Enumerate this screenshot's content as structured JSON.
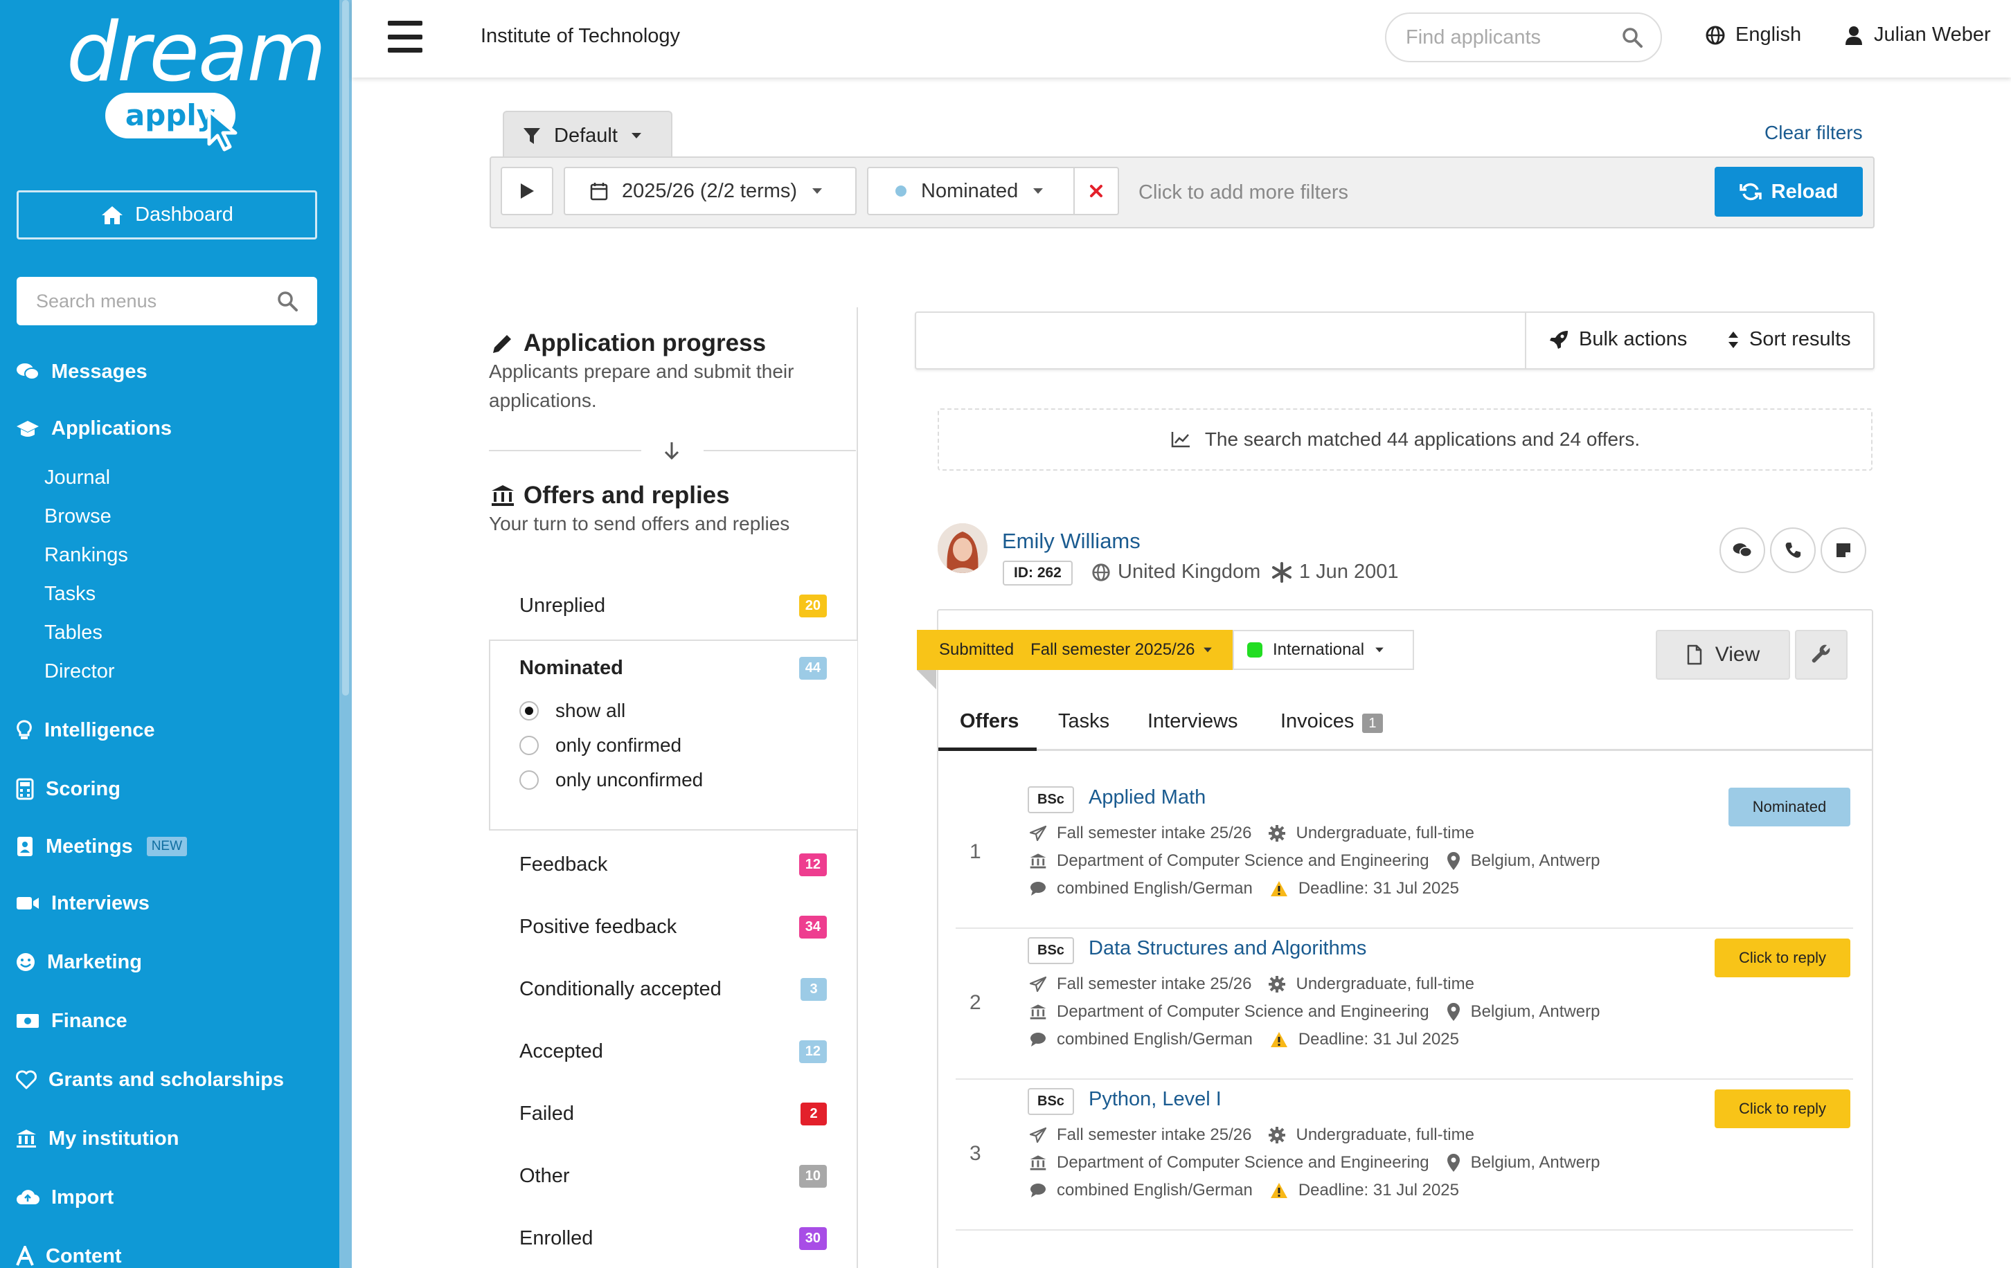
{
  "sidebar": {
    "logo_top": "dream",
    "logo_bottom": "apply",
    "dashboard_label": "Dashboard",
    "search_placeholder": "Search menus",
    "nav": [
      {
        "label": "Messages",
        "icon": "comments-icon"
      },
      {
        "label": "Applications",
        "icon": "graduation-cap-icon"
      },
      {
        "label": "Intelligence",
        "icon": "lightbulb-icon"
      },
      {
        "label": "Scoring",
        "icon": "calculator-icon"
      },
      {
        "label": "Meetings",
        "icon": "contact-card-icon",
        "badge": "NEW"
      },
      {
        "label": "Interviews",
        "icon": "video-icon"
      },
      {
        "label": "Marketing",
        "icon": "smile-icon"
      },
      {
        "label": "Finance",
        "icon": "money-icon"
      },
      {
        "label": "Grants and scholarships",
        "icon": "heart-icon"
      },
      {
        "label": "My institution",
        "icon": "institution-icon"
      },
      {
        "label": "Import",
        "icon": "cloud-upload-icon"
      },
      {
        "label": "Content",
        "icon": "font-icon"
      }
    ],
    "sub_items": [
      "Journal",
      "Browse",
      "Rankings",
      "Tasks",
      "Tables",
      "Director"
    ]
  },
  "header": {
    "institution": "Institute of Technology",
    "find_placeholder": "Find applicants",
    "language": "English",
    "user": "Julian Weber"
  },
  "filters": {
    "preset": "Default",
    "clear_label": "Clear filters",
    "term": "2025/26 (2/2 terms)",
    "status": "Nominated",
    "add_more": "Click to add more filters",
    "reload_label": "Reload"
  },
  "progress": {
    "title": "Application progress",
    "description": "Applicants prepare and submit their applications.",
    "offers_title": "Offers and replies",
    "offers_description": "Your turn to send offers and replies",
    "unreplied": {
      "label": "Unreplied",
      "count": "20"
    },
    "nominated": {
      "label": "Nominated",
      "count": "44"
    },
    "radio_options": [
      "show all",
      "only confirmed",
      "only unconfirmed"
    ],
    "radio_selected": "show all",
    "statuses": [
      {
        "label": "Feedback",
        "count": "12",
        "color": "#ee3d8f"
      },
      {
        "label": "Positive feedback",
        "count": "34",
        "color": "#ee3d8f"
      },
      {
        "label": "Conditionally accepted",
        "count": "3",
        "color": "#9ccbe6"
      },
      {
        "label": "Accepted",
        "count": "12",
        "color": "#9ccbe6"
      },
      {
        "label": "Failed",
        "count": "2",
        "color": "#e3202b"
      },
      {
        "label": "Other",
        "count": "10",
        "color": "#a8a8a8"
      },
      {
        "label": "Enrolled",
        "count": "30",
        "color": "#a84de6"
      }
    ]
  },
  "results": {
    "bulk_actions": "Bulk actions",
    "sort_results": "Sort results",
    "match_text": "The search matched 44 applications and 24 offers."
  },
  "applicant": {
    "name": "Emily Williams",
    "id": "ID: 262",
    "country": "United Kingdom",
    "birth_date": "1 Jun 2001",
    "status": "Submitted",
    "intake": "Fall semester 2025/26",
    "category": "International",
    "category_color": "#22dd22",
    "view_label": "View",
    "tabs": [
      {
        "label": "Offers"
      },
      {
        "label": "Tasks"
      },
      {
        "label": "Interviews"
      },
      {
        "label": "Invoices",
        "count": "1"
      }
    ],
    "offers": [
      {
        "num": "1",
        "degree": "BSc",
        "name": "Applied Math",
        "intake": "Fall semester intake 25/26",
        "level": "Undergraduate, full-time",
        "department": "Department of Computer Science and Engineering",
        "location": "Belgium, Antwerp",
        "language": "combined English/German",
        "deadline": "Deadline: 31 Jul 2025",
        "status": "Nominated",
        "status_color": "#9ccbe6"
      },
      {
        "num": "2",
        "degree": "BSc",
        "name": "Data Structures and Algorithms",
        "intake": "Fall semester intake 25/26",
        "level": "Undergraduate, full-time",
        "department": "Department of Computer Science and Engineering",
        "location": "Belgium, Antwerp",
        "language": "combined English/German",
        "deadline": "Deadline: 31 Jul 2025",
        "status": "Click to reply",
        "status_color": "#f8c418"
      },
      {
        "num": "3",
        "degree": "BSc",
        "name": "Python, Level I",
        "intake": "Fall semester intake 25/26",
        "level": "Undergraduate, full-time",
        "department": "Department of Computer Science and Engineering",
        "location": "Belgium, Antwerp",
        "language": "combined English/German",
        "deadline": "Deadline: 31 Jul 2025",
        "status": "Click to reply",
        "status_color": "#f8c418"
      }
    ]
  }
}
